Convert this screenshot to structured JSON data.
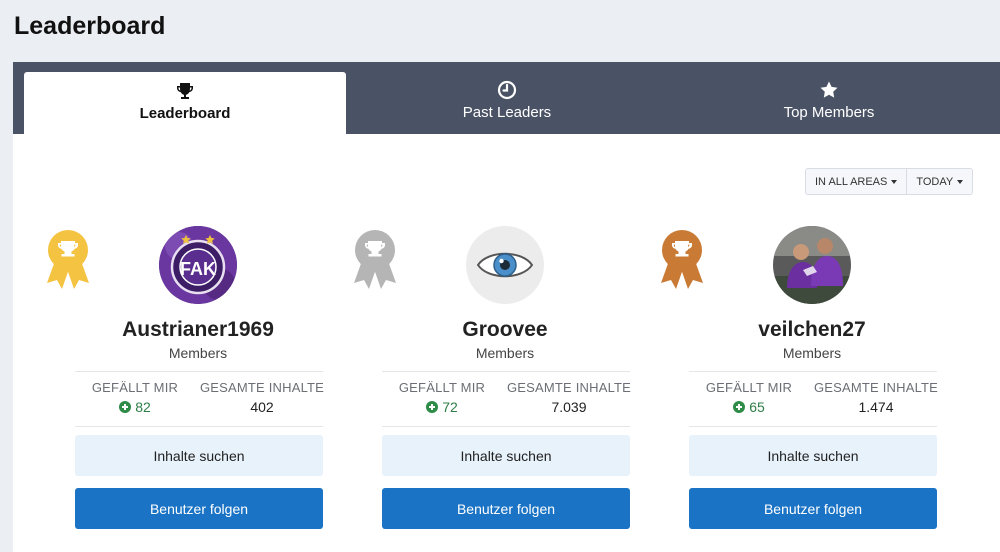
{
  "page": {
    "title": "Leaderboard"
  },
  "tabs": [
    {
      "label": "Leaderboard",
      "icon": "trophy-icon",
      "active": true
    },
    {
      "label": "Past Leaders",
      "icon": "clock-icon",
      "active": false
    },
    {
      "label": "Top Members",
      "icon": "star-icon",
      "active": false
    }
  ],
  "filters": {
    "area": "IN ALL AREAS",
    "period": "TODAY"
  },
  "colors": {
    "gold": "#f5c342",
    "silver": "#b5b5b5",
    "bronze": "#c97b35",
    "primary": "#1a73c4",
    "tabbar": "#4a5365",
    "reputation": "#2e7d46"
  },
  "stat_labels": {
    "likes": "GEFÄLLT MIR",
    "content": "GESAMTE INHALTE"
  },
  "leaders": [
    {
      "rank": 1,
      "medal": "gold",
      "username": "Austrianer1969",
      "group": "Members",
      "likes": "82",
      "content": "402",
      "find_content": "Inhalte suchen",
      "follow": "Benutzer folgen",
      "avatar": "fak-club-crest-avatar",
      "crest_letters": "FAK"
    },
    {
      "rank": 2,
      "medal": "silver",
      "username": "Groovee",
      "group": "Members",
      "likes": "72",
      "content": "7.039",
      "find_content": "Inhalte suchen",
      "follow": "Benutzer folgen",
      "avatar": "eye-avatar"
    },
    {
      "rank": 3,
      "medal": "bronze",
      "username": "veilchen27",
      "group": "Members",
      "likes": "65",
      "content": "1.474",
      "find_content": "Inhalte suchen",
      "follow": "Benutzer folgen",
      "avatar": "football-players-photo-avatar"
    }
  ]
}
